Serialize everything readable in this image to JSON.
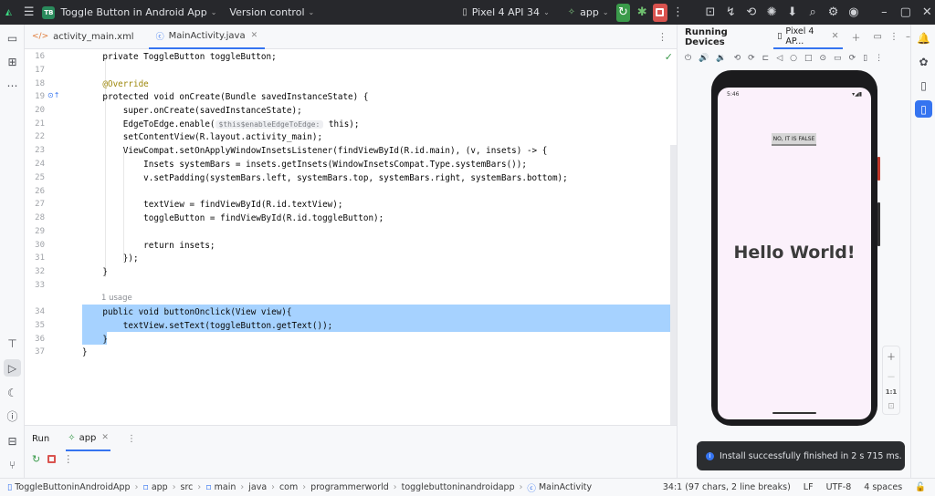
{
  "titlebar": {
    "project_badge": "TB",
    "project_name": "Toggle Button in Android App",
    "vcs": "Version control",
    "device": "Pixel 4 API 34",
    "run_config": "app"
  },
  "editor": {
    "tabs": [
      {
        "label": "activity_main.xml",
        "icon": "xml-icon"
      },
      {
        "label": "MainActivity.java",
        "icon": "java-class-icon"
      }
    ],
    "line_numbers": [
      "16",
      "17",
      "18",
      "19",
      "20",
      "21",
      "22",
      "23",
      "24",
      "25",
      "26",
      "27",
      "28",
      "29",
      "30",
      "31",
      "32",
      "33",
      "34",
      "35",
      "36",
      "37"
    ],
    "code": [
      "    private ToggleButton toggleButton;",
      "",
      "    @Override",
      "    protected void onCreate(Bundle savedInstanceState) {",
      "        super.onCreate(savedInstanceState);",
      "        EdgeToEdge.enable(",
      "        setContentView(R.layout.activity_main);",
      "        ViewCompat.setOnApplyWindowInsetsListener(findViewById(R.id.main), (v, insets) -> {",
      "            Insets systemBars = insets.getInsets(WindowInsetsCompat.Type.systemBars());",
      "            v.setPadding(systemBars.left, systemBars.top, systemBars.right, systemBars.bottom);",
      "",
      "            textView = findViewById(R.id.textView);",
      "            toggleButton = findViewById(R.id.toggleButton);",
      "",
      "            return insets;",
      "        });",
      "    }",
      "",
      "    public void buttonOnclick(View view){",
      "        textView.setText(toggleButton.getText());",
      "    }",
      "}"
    ],
    "inlay_hint": "$this$enableEdgeToEdge:",
    "inlay_after": " this);",
    "usage_hint": "1 usage"
  },
  "devices": {
    "title": "Running Devices",
    "tab": "Pixel 4 AP...",
    "phone_time": "5:46",
    "toggle_text": "NO, IT IS FALSE",
    "hello_text": "Hello World!",
    "zoom_ratio": "1:1"
  },
  "run": {
    "tab_run": "Run",
    "tab_app": "app"
  },
  "toast": {
    "message": "Install successfully finished in 2 s 715 ms."
  },
  "statusbar": {
    "breadcrumbs": [
      "ToggleButtoninAndroidApp",
      "app",
      "src",
      "main",
      "java",
      "com",
      "programmerworld",
      "togglebuttoninandroidapp",
      "MainActivity"
    ],
    "position": "34:1 (97 chars, 2 line breaks)",
    "line_sep": "LF",
    "encoding": "UTF-8",
    "indent": "4 spaces"
  }
}
